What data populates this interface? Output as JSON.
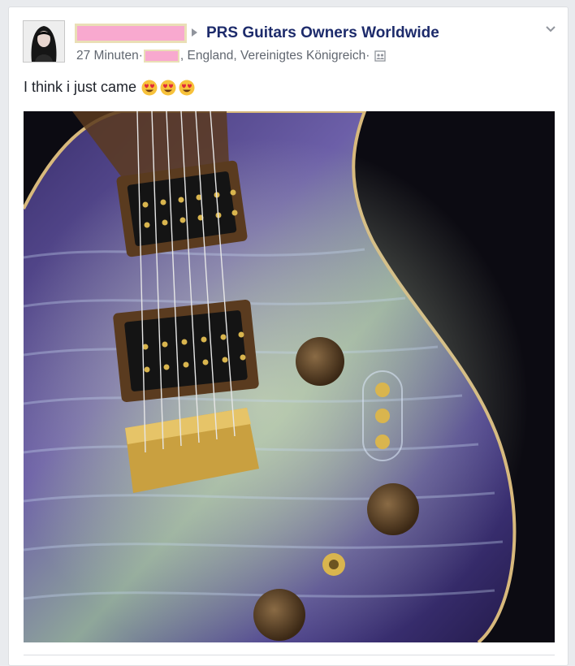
{
  "post": {
    "group_name": "PRS Guitars Owners Worldwide",
    "timestamp": "27 Minuten",
    "separator": " · ",
    "location": ", England, Vereinigtes Königreich",
    "separator_end": " · ",
    "text": "I think i just came",
    "emoji_count": 3
  },
  "icons": {
    "more_menu": "chevron-down-icon",
    "audience": "group-audience-icon",
    "share_arrow": "arrow-right-icon",
    "emoji": "heart-eyes-emoji"
  },
  "colors": {
    "group_link": "#1d2b6b",
    "meta_text": "#616770",
    "redaction_fill": "#f8a9cf",
    "redaction_border": "#eadfb6"
  }
}
